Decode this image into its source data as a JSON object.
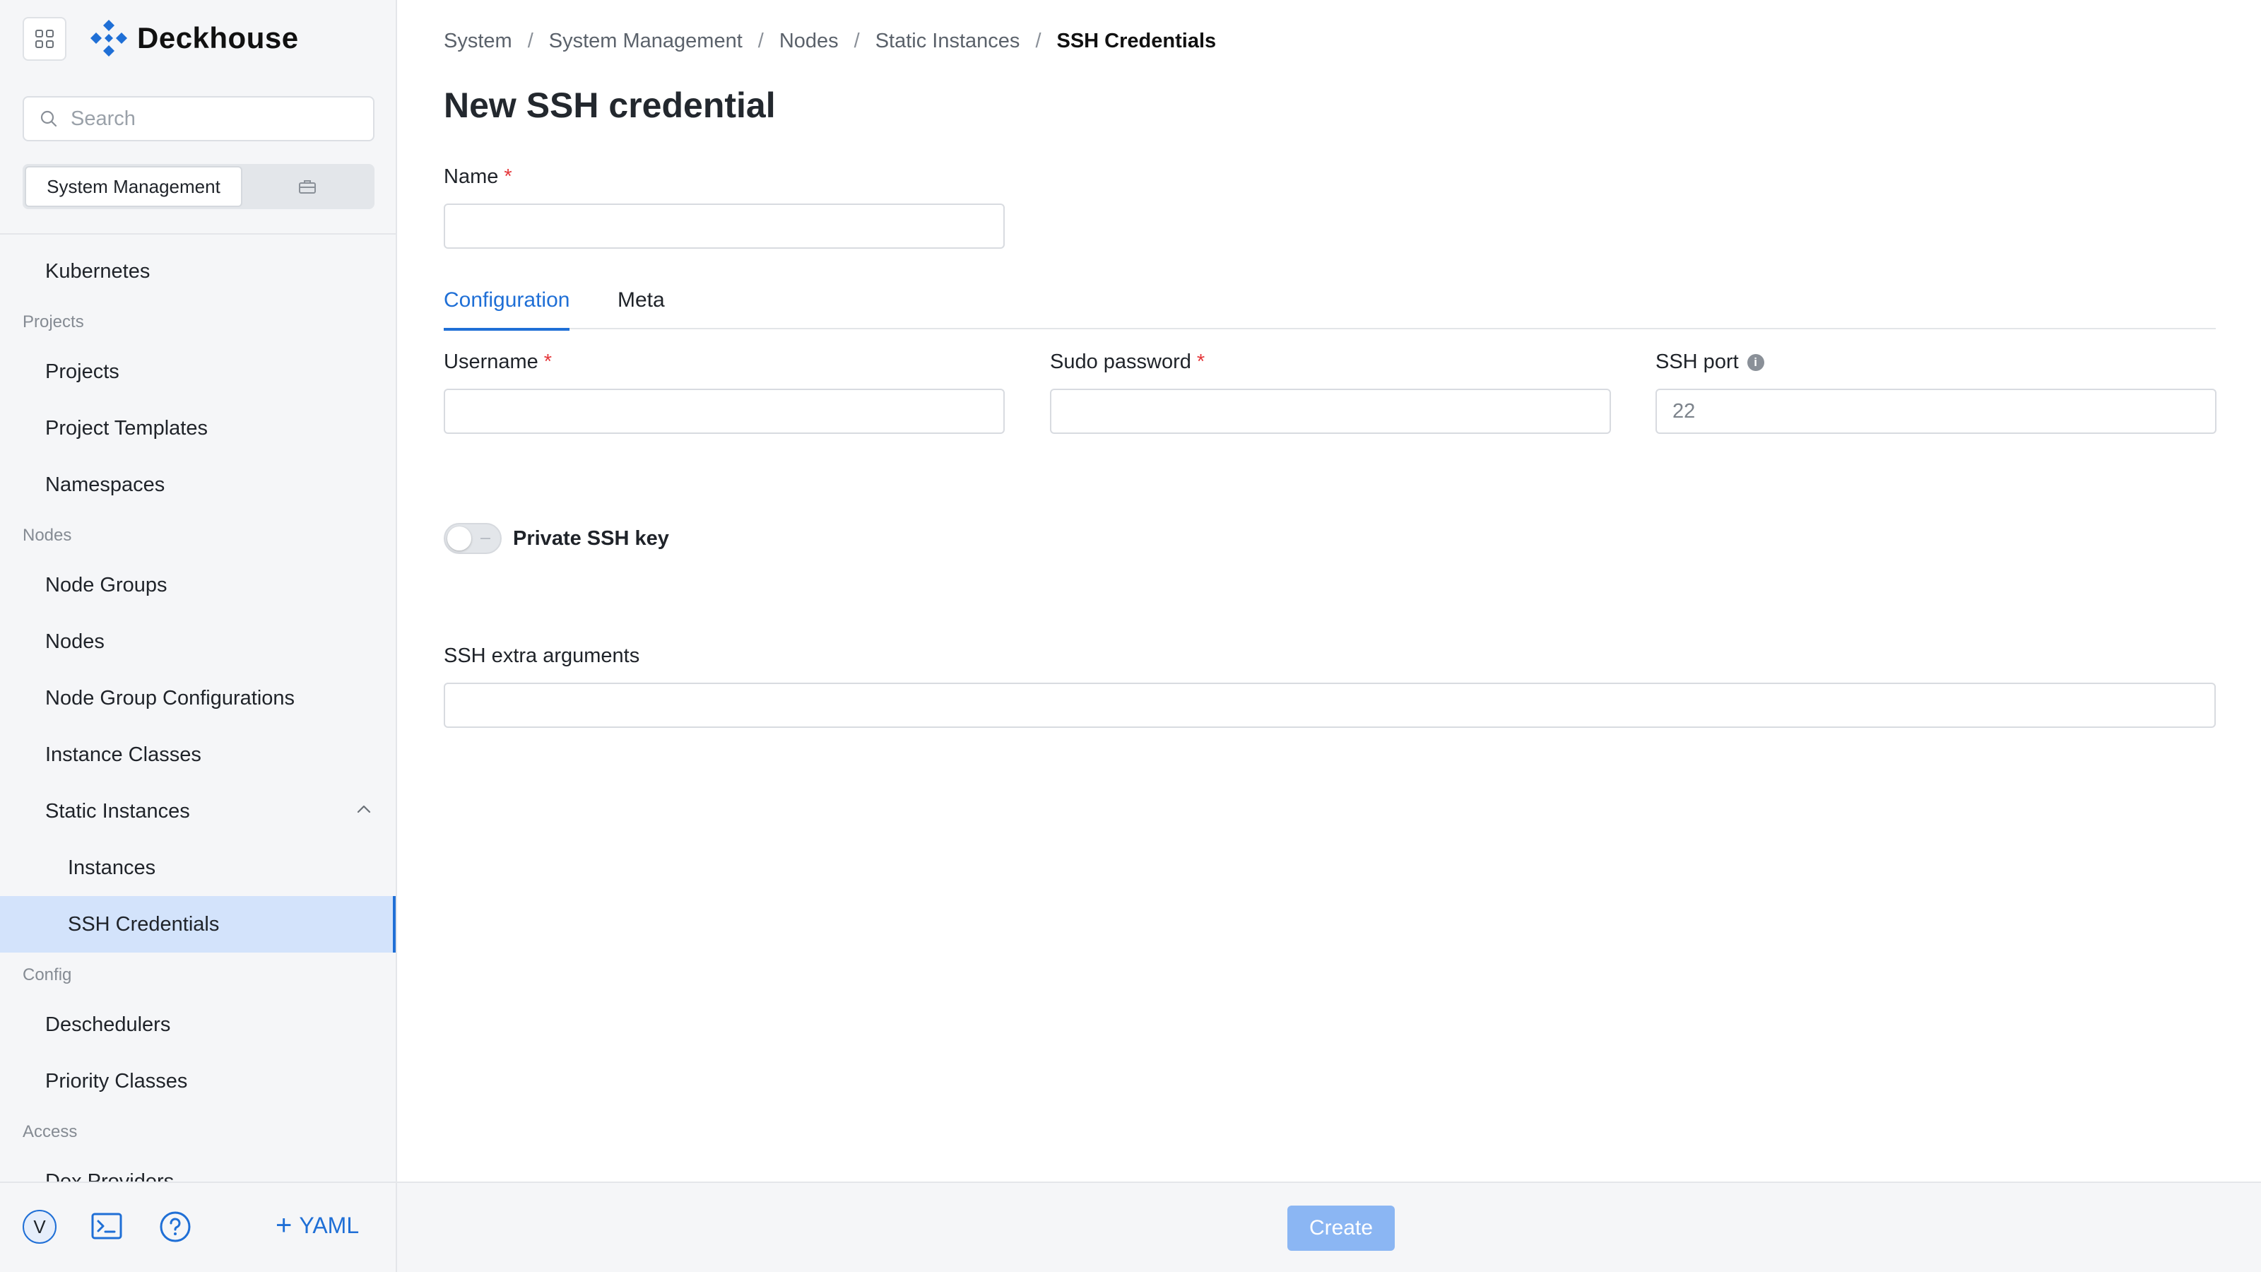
{
  "app": {
    "name": "Deckhouse"
  },
  "search": {
    "placeholder": "Search"
  },
  "switcher": {
    "active_label": "System Management"
  },
  "sidebar": {
    "kubernetes": "Kubernetes",
    "sections": {
      "projects": "Projects",
      "nodes": "Nodes",
      "config": "Config",
      "access": "Access"
    },
    "items": {
      "projects": "Projects",
      "project_templates": "Project Templates",
      "namespaces": "Namespaces",
      "node_groups": "Node Groups",
      "nodes": "Nodes",
      "node_group_configurations": "Node Group Configurations",
      "instance_classes": "Instance Classes",
      "static_instances": "Static Instances",
      "instances": "Instances",
      "ssh_credentials": "SSH Credentials",
      "deschedulers": "Deschedulers",
      "priority_classes": "Priority Classes",
      "dex_providers": "Dex Providers"
    }
  },
  "sidebar_footer": {
    "avatar_initial": "V",
    "yaml_label": "YAML"
  },
  "breadcrumb": [
    "System",
    "System Management",
    "Nodes",
    "Static Instances",
    "SSH Credentials"
  ],
  "page": {
    "title": "New SSH credential"
  },
  "form": {
    "name_label": "Name",
    "required_mark": "*",
    "tabs": [
      "Configuration",
      "Meta"
    ],
    "username_label": "Username",
    "sudo_password_label": "Sudo password",
    "ssh_port_label": "SSH port",
    "ssh_port_placeholder": "22",
    "private_key_label": "Private SSH key",
    "private_key_enabled": false,
    "extra_args_label": "SSH extra arguments"
  },
  "actions": {
    "create_label": "Create"
  },
  "colors": {
    "accent": "#1f6fd6",
    "active_bg": "#d3e3fb",
    "required": "#e5383b",
    "create_disabled": "#8bb6f3"
  }
}
